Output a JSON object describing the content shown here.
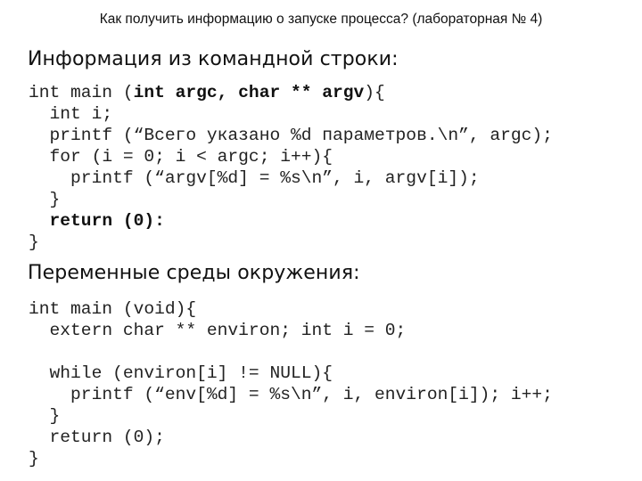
{
  "slide": {
    "title": "Как получить информацию о запуске процесса? (лабораторная № 4)",
    "section1": {
      "heading": "Информация из командной строки:",
      "code_lines": [
        {
          "indent": "",
          "parts": [
            {
              "text": "int main (",
              "bold": false
            },
            {
              "text": "int argc, char ** argv",
              "bold": true
            },
            {
              "text": "){",
              "bold": false
            }
          ]
        },
        {
          "indent": "  ",
          "parts": [
            {
              "text": "int i;",
              "bold": false
            }
          ]
        },
        {
          "indent": "  ",
          "parts": [
            {
              "text": "printf (“Всего указано %d параметров.\\n”, argc);",
              "bold": false
            }
          ]
        },
        {
          "indent": "  ",
          "parts": [
            {
              "text": "for (i = 0; i < argc; i++){",
              "bold": false
            }
          ]
        },
        {
          "indent": "    ",
          "parts": [
            {
              "text": "printf (“argv[%d] = %s\\n”, i, argv[i]);",
              "bold": false
            }
          ]
        },
        {
          "indent": "  ",
          "parts": [
            {
              "text": "}",
              "bold": false
            }
          ]
        },
        {
          "indent": "  ",
          "parts": [
            {
              "text": "return (0):",
              "bold": true
            }
          ]
        },
        {
          "indent": "",
          "parts": [
            {
              "text": "}",
              "bold": false
            }
          ]
        }
      ]
    },
    "section2": {
      "heading": "Переменные среды окружения:",
      "code_lines": [
        {
          "indent": "",
          "parts": [
            {
              "text": "int main (void){",
              "bold": false
            }
          ]
        },
        {
          "indent": "  ",
          "parts": [
            {
              "text": "extern char ** environ; int i = 0;",
              "bold": false
            }
          ]
        },
        {
          "indent": "",
          "parts": [
            {
              "text": "",
              "bold": false
            }
          ]
        },
        {
          "indent": "  ",
          "parts": [
            {
              "text": "while (environ[i] != NULL){",
              "bold": false
            }
          ]
        },
        {
          "indent": "    ",
          "parts": [
            {
              "text": "printf (“env[%d] = %s\\n”, i, environ[i]); i++;",
              "bold": false
            }
          ]
        },
        {
          "indent": "  ",
          "parts": [
            {
              "text": "}",
              "bold": false
            }
          ]
        },
        {
          "indent": "  ",
          "parts": [
            {
              "text": "return (0);",
              "bold": false
            }
          ]
        },
        {
          "indent": "",
          "parts": [
            {
              "text": "}",
              "bold": false
            }
          ]
        }
      ]
    }
  }
}
